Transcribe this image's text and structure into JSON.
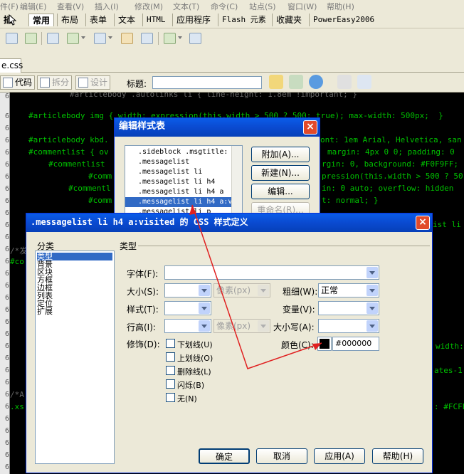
{
  "menu": {
    "items": [
      "件(F)",
      "编辑(E)",
      "查看(V)",
      "插入(I)",
      "修改(M)",
      "文本(T)",
      "命令(C)",
      "站点(S)",
      "窗口(W)",
      "帮助(H)"
    ]
  },
  "insert_bar": {
    "menu_label": "插",
    "tabs": [
      "常用",
      "布局",
      "表单",
      "文本",
      "HTML",
      "应用程序",
      "Flash 元素",
      "收藏夹",
      "PowerEasy2006"
    ],
    "active_tab": "常用"
  },
  "file_tab": {
    "name": "e.css"
  },
  "doc_toolbar": {
    "code_label": "代码",
    "split_label": "拆分",
    "design_label": "设计",
    "title_label": "标题:",
    "title_value": ""
  },
  "editor": {
    "line_numbers": [
      "6",
      "6",
      "6",
      "6",
      "6",
      "6",
      "6",
      "6",
      "6",
      "6",
      "6",
      "6",
      "6",
      "6",
      "6",
      "6",
      "6",
      "6",
      "6",
      "6",
      "6",
      "6",
      "6",
      "6",
      "6",
      "6",
      "6",
      "6",
      "6",
      "6",
      "6"
    ],
    "lines": {
      "l1": "#articlebody .autolinks li { line-height: 1.8em !important; }",
      "l2": "#articlebody img { width: expression(this.width > 500 ? 500: true); max-width: 500px;  }",
      "l3a": "#articlebody kbd.",
      "l3b": "ont: 1em Arial, Helvetica, san",
      "l4a": "#commentlist { ov",
      "l4b": "margin: 4px 0 0; padding: 0",
      "l5a": "#commentlist",
      "l5b": "rgin: 0, background: #F0F9FF;",
      "l6a": "#comm",
      "l6b": "pression(this.width > 500 ? 50",
      "l7a": "#commentl",
      "l7b": "in: 0 auto; overflow: hidden",
      "l8a": "#comm",
      "l8b": "t: normal; }",
      "l9": "ist li",
      "l10": "/*发",
      "l11": "#co",
      "l12": "width:",
      "l13": "ates-1",
      "l14": "/*A",
      "l15a": ".xs",
      "l15b": ": #FCFE"
    }
  },
  "style_dialog": {
    "title": "编辑样式表",
    "close_symbol": "×",
    "list_items": [
      ".sideblock .msgtitle:",
      ".messagelist",
      ".messagelist li",
      ".messagelist li h4",
      ".messagelist li h4 a",
      ".messagelist li h4 a:v",
      ".messagelist li p"
    ],
    "selected_index": 5,
    "buttons": {
      "attach": "附加(A)...",
      "new": "新建(N)...",
      "edit": "编辑...",
      "rename": "重命名(R)..."
    }
  },
  "css_dialog": {
    "title": ".messagelist li h4 a:visited 的 CSS 样式定义",
    "close_symbol": "×",
    "category_label": "分类",
    "categories": [
      "类型",
      "背景",
      "区块",
      "方框",
      "边框",
      "列表",
      "定位",
      "扩展"
    ],
    "selected_category": "类型",
    "section_label": "类型",
    "fields": {
      "font_label": "字体(F):",
      "font_value": "",
      "size_label": "大小(S):",
      "size_value": "",
      "size_unit": "像素(px)",
      "weight_label": "粗细(W):",
      "weight_value": "正常",
      "style_label": "样式(T):",
      "style_value": "",
      "variant_label": "变量(V):",
      "variant_value": "",
      "line_height_label": "行高(I):",
      "line_height_value": "",
      "line_height_unit": "像素(px)",
      "case_label": "大小写(A):",
      "case_value": "",
      "decoration_label": "修饰(D):",
      "color_label": "颜色(C):",
      "color_value": "#000000"
    },
    "decorations": [
      "下划线(U)",
      "上划线(O)",
      "删除线(L)",
      "闪烁(B)",
      "无(N)"
    ],
    "buttons": {
      "ok": "确定",
      "cancel": "取消",
      "apply": "应用(A)",
      "help": "帮助(H)"
    }
  },
  "colors": {
    "editor_bg": "#000000",
    "code_green": "#00c000",
    "titlebar_blue": "#0a4ad0",
    "selection_blue": "#316ac5",
    "annotation_red": "#e02020",
    "dialog_bg": "#ece9d8"
  }
}
